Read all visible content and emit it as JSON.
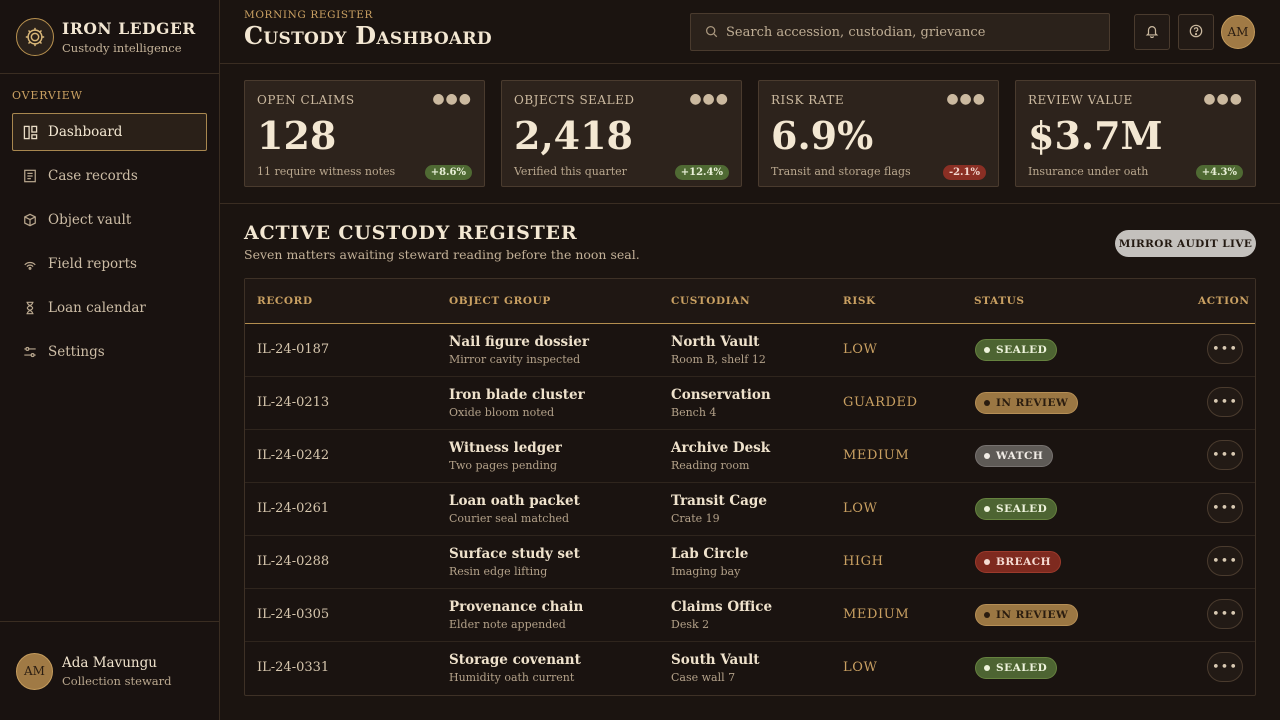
{
  "brand": {
    "name": "IRON LEDGER",
    "subtitle": "Custody intelligence"
  },
  "sidebar": {
    "heading": "OVERVIEW",
    "items": [
      {
        "label": "Dashboard",
        "icon": "dashboard-icon",
        "active": true
      },
      {
        "label": "Case records",
        "icon": "document-icon"
      },
      {
        "label": "Object vault",
        "icon": "cube-icon"
      },
      {
        "label": "Field reports",
        "icon": "signal-icon"
      },
      {
        "label": "Loan calendar",
        "icon": "hourglass-icon"
      },
      {
        "label": "Settings",
        "icon": "sliders-icon"
      }
    ],
    "user": {
      "initials": "AM",
      "name": "Ada Mavungu",
      "role": "Collection steward"
    }
  },
  "header": {
    "eyebrow": "MORNING REGISTER",
    "title": "Custody Dashboard",
    "search_placeholder": "Search accession, custodian, grievance",
    "user_initials": "AM"
  },
  "kpis": [
    {
      "label": "OPEN CLAIMS",
      "value": "128",
      "note": "11 require witness notes",
      "delta": "+8.6%",
      "trend": "up"
    },
    {
      "label": "OBJECTS SEALED",
      "value": "2,418",
      "note": "Verified this quarter",
      "delta": "+12.4%",
      "trend": "up"
    },
    {
      "label": "RISK RATE",
      "value": "6.9%",
      "note": "Transit and storage flags",
      "delta": "-2.1%",
      "trend": "down"
    },
    {
      "label": "REVIEW VALUE",
      "value": "$3.7M",
      "note": "Insurance under oath",
      "delta": "+4.3%",
      "trend": "up"
    }
  ],
  "register": {
    "title": "ACTIVE CUSTODY REGISTER",
    "subtitle": "Seven matters awaiting steward reading before the noon seal.",
    "audit_button": "MIRROR AUDIT LIVE",
    "columns": [
      "RECORD",
      "OBJECT GROUP",
      "CUSTODIAN",
      "RISK",
      "STATUS",
      "ACTION"
    ],
    "rows": [
      {
        "id": "IL-24-0187",
        "object": "Nail figure dossier",
        "object_note": "Mirror cavity inspected",
        "custodian": "North Vault",
        "location": "Room B, shelf 12",
        "risk": "LOW",
        "status": "SEALED",
        "status_kind": "sealed"
      },
      {
        "id": "IL-24-0213",
        "object": "Iron blade cluster",
        "object_note": "Oxide bloom noted",
        "custodian": "Conservation",
        "location": "Bench 4",
        "risk": "GUARDED",
        "status": "IN REVIEW",
        "status_kind": "review"
      },
      {
        "id": "IL-24-0242",
        "object": "Witness ledger",
        "object_note": "Two pages pending",
        "custodian": "Archive Desk",
        "location": "Reading room",
        "risk": "MEDIUM",
        "status": "WATCH",
        "status_kind": "watch"
      },
      {
        "id": "IL-24-0261",
        "object": "Loan oath packet",
        "object_note": "Courier seal matched",
        "custodian": "Transit Cage",
        "location": "Crate 19",
        "risk": "LOW",
        "status": "SEALED",
        "status_kind": "sealed"
      },
      {
        "id": "IL-24-0288",
        "object": "Surface study set",
        "object_note": "Resin edge lifting",
        "custodian": "Lab Circle",
        "location": "Imaging bay",
        "risk": "HIGH",
        "status": "BREACH",
        "status_kind": "breach"
      },
      {
        "id": "IL-24-0305",
        "object": "Provenance chain",
        "object_note": "Elder note appended",
        "custodian": "Claims Office",
        "location": "Desk 2",
        "risk": "MEDIUM",
        "status": "IN REVIEW",
        "status_kind": "review"
      },
      {
        "id": "IL-24-0331",
        "object": "Storage covenant",
        "object_note": "Humidity oath current",
        "custodian": "South Vault",
        "location": "Case wall 7",
        "risk": "LOW",
        "status": "SEALED",
        "status_kind": "sealed"
      }
    ]
  },
  "colors": {
    "accent": "#c9a062",
    "background": "#1b1410",
    "panel": "#2d231c",
    "sealed": "#4d6432",
    "review": "#9b7743",
    "watch": "#5e5a56",
    "breach": "#7e2a1f"
  }
}
